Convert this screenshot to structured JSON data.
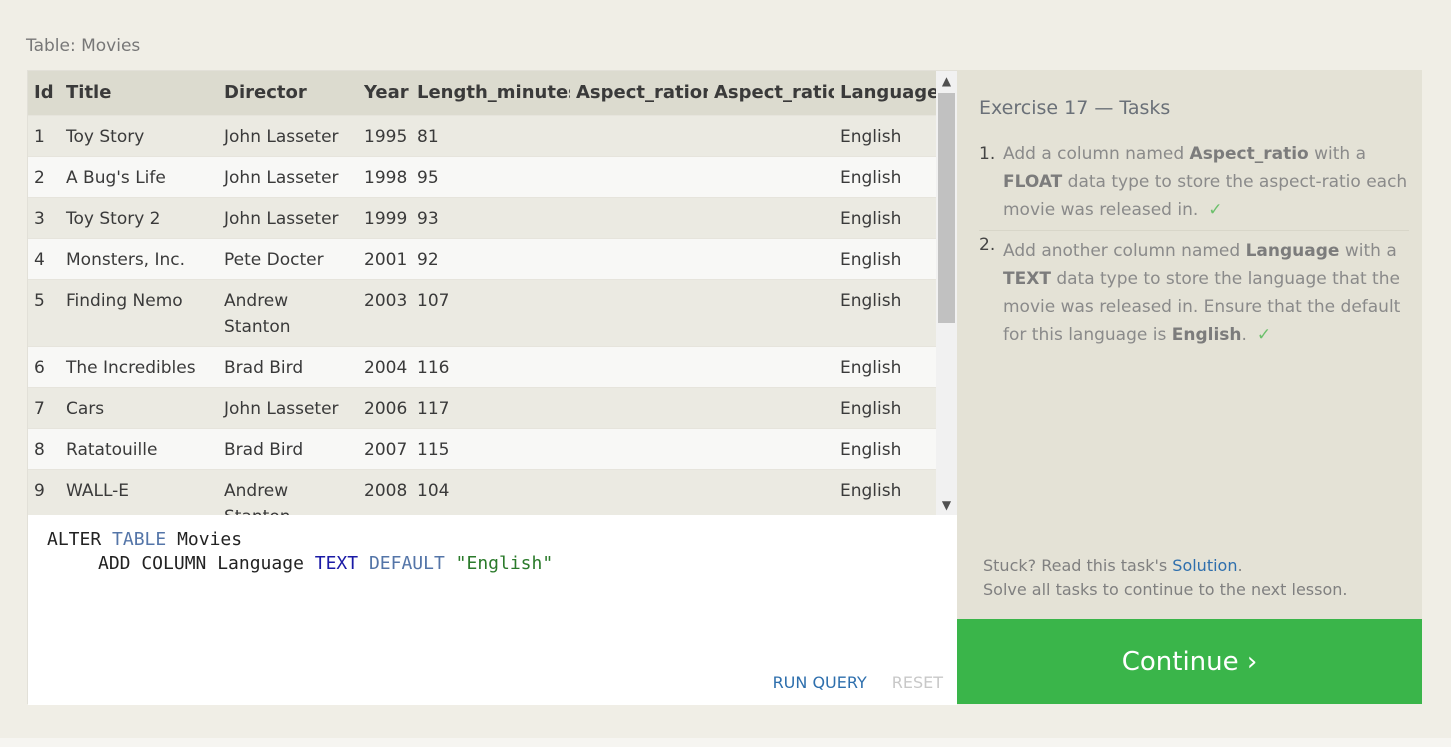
{
  "table_title": "Table: Movies",
  "table": {
    "columns": [
      "Id",
      "Title",
      "Director",
      "Year",
      "Length_minutes",
      "Aspect_ration",
      "Aspect_ratio",
      "Language"
    ],
    "rows": [
      [
        "1",
        "Toy Story",
        "John Lasseter",
        "1995",
        "81",
        "",
        "",
        "English"
      ],
      [
        "2",
        "A Bug's Life",
        "John Lasseter",
        "1998",
        "95",
        "",
        "",
        "English"
      ],
      [
        "3",
        "Toy Story 2",
        "John Lasseter",
        "1999",
        "93",
        "",
        "",
        "English"
      ],
      [
        "4",
        "Monsters, Inc.",
        "Pete Docter",
        "2001",
        "92",
        "",
        "",
        "English"
      ],
      [
        "5",
        "Finding Nemo",
        "Andrew Stanton",
        "2003",
        "107",
        "",
        "",
        "English"
      ],
      [
        "6",
        "The Incredibles",
        "Brad Bird",
        "2004",
        "116",
        "",
        "",
        "English"
      ],
      [
        "7",
        "Cars",
        "John Lasseter",
        "2006",
        "117",
        "",
        "",
        "English"
      ],
      [
        "8",
        "Ratatouille",
        "Brad Bird",
        "2007",
        "115",
        "",
        "",
        "English"
      ],
      [
        "9",
        "WALL-E",
        "Andrew Stanton",
        "2008",
        "104",
        "",
        "",
        "English"
      ]
    ]
  },
  "scrollbar": {
    "up_icon": "▲",
    "down_icon": "▼"
  },
  "editor": {
    "line1": {
      "w1": "ALTER",
      "w2": "TABLE",
      "w3": "Movies"
    },
    "line2": {
      "w1": "ADD COLUMN Language",
      "w2": "TEXT",
      "w3": "DEFAULT",
      "w4": "\"English\""
    },
    "run_label": "RUN QUERY",
    "reset_label": "RESET"
  },
  "exercise": {
    "title": "Exercise 17 — Tasks",
    "tasks": [
      {
        "num": "1.",
        "p1": "Add a column named ",
        "b1": "Aspect_ratio",
        "p2": " with a ",
        "b2": "FLOAT",
        "p3": " data type to store the aspect-ratio each movie was released in.",
        "check": "✓"
      },
      {
        "num": "2.",
        "p1": "Add another column named ",
        "b1": "Language",
        "p2": " with a ",
        "b2": "TEXT",
        "p3": " data type to store the language that the movie was released in. Ensure that the default for this language is ",
        "b3": "English",
        "p4": ".",
        "check": "✓"
      }
    ],
    "hint_prefix": "Stuck? Read this task's ",
    "hint_link": "Solution",
    "hint_suffix": ".",
    "hint_line2": "Solve all tasks to continue to the next lesson.",
    "continue_label": "Continue ›"
  },
  "colors": {
    "continue": "#3ab54a",
    "link": "#2e6fad",
    "check": "#6cc06c"
  }
}
